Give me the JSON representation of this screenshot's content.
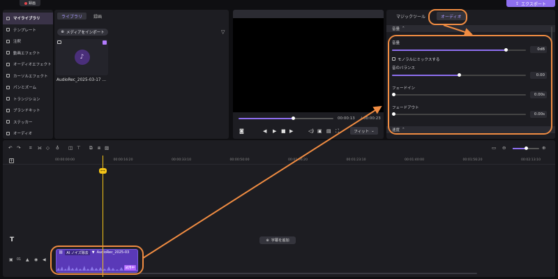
{
  "topbar": {
    "record_label": "録画",
    "export_label": "エクスポート"
  },
  "sidebar": {
    "items": [
      {
        "label": "マイライブラリ",
        "icon": "library-icon",
        "active": true
      },
      {
        "label": "テンプレート",
        "icon": "template-icon"
      },
      {
        "label": "注釈",
        "icon": "annotation-icon"
      },
      {
        "label": "動画エフェクト",
        "icon": "video-effect-icon"
      },
      {
        "label": "オーディオエフェクト",
        "icon": "audio-effect-icon"
      },
      {
        "label": "カーソルエフェクト",
        "icon": "cursor-effect-icon"
      },
      {
        "label": "パンとズーム",
        "icon": "pan-zoom-icon"
      },
      {
        "label": "トランジション",
        "icon": "transition-icon"
      },
      {
        "label": "ブランドキット",
        "icon": "brand-kit-icon"
      },
      {
        "label": "ステッカー",
        "icon": "sticker-icon"
      },
      {
        "label": "オーディオ",
        "icon": "audio-icon"
      }
    ]
  },
  "media": {
    "tabs": [
      {
        "label": "ライブラリ",
        "active": true
      },
      {
        "label": "録画",
        "active": false
      }
    ],
    "import_label": "メディアをインポート",
    "item_name": "AudioRec_2025-03-17 ..."
  },
  "preview": {
    "current_time": "00:00:13",
    "total_time": "00:00:23",
    "fit_label": "フィット",
    "progress": 0.57
  },
  "properties": {
    "tabs": [
      {
        "label": "マジックツール",
        "active": false
      },
      {
        "label": "オーディオ",
        "active": true
      }
    ],
    "volume_section": "音量",
    "volume_label": "音量",
    "volume_value": "0dB",
    "volume_level": 0.85,
    "mono_label": "モノラルにミックスする",
    "balance_label": "音のバランス",
    "balance_value": "0.00",
    "balance_level": 0.5,
    "fade_in_label": "フェードイン",
    "fade_in_value": "0.00s",
    "fade_out_label": "フェードアウト",
    "fade_out_value": "0.00s",
    "speed_section": "速度"
  },
  "timeline": {
    "ticks": [
      "00:00:00:00",
      "00:00:16:20",
      "00:00:33:10",
      "00:00:50:00",
      "00:01:06:20",
      "00:01:23:10",
      "00:01:40:00",
      "00:01:56:20",
      "00:02:13:10"
    ],
    "add_subtitle_label": "字幕を追加",
    "track_number": "01",
    "clip": {
      "ai_label": "AI ノイズ除去",
      "name": "AudioRec_2025-03",
      "tag": "試用中"
    },
    "zoom_level": 0.5
  },
  "colors": {
    "accent": "#8e6ff0",
    "annotation": "#f08c42",
    "playhead": "#f5c518"
  }
}
